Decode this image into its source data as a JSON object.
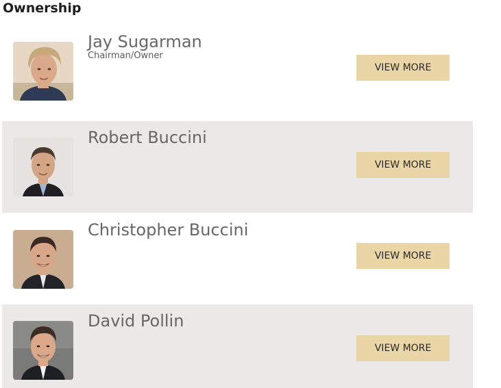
{
  "section": {
    "title": "Ownership"
  },
  "people": [
    {
      "name": "Jay Sugarman",
      "role": "Chairman/Owner",
      "button": "VIEW MORE",
      "photo": "portrait-photo",
      "photo_bg": "#e7d8c6",
      "hair": "#c6a87a",
      "skin": "#d9a98a",
      "suit": "#2f3a55"
    },
    {
      "name": "Robert Buccini",
      "role": "",
      "button": "VIEW MORE",
      "photo": "portrait-photo",
      "photo_bg": "#e6e2df",
      "hair": "#4a3a30",
      "skin": "#d4a585",
      "suit": "#1f1f24"
    },
    {
      "name": "Christopher Buccini",
      "role": "",
      "button": "VIEW MORE",
      "photo": "portrait-photo",
      "photo_bg": "#c9ad90",
      "hair": "#3a2a22",
      "skin": "#d7a787",
      "suit": "#232428"
    },
    {
      "name": "David Pollin",
      "role": "",
      "button": "VIEW MORE",
      "photo": "portrait-photo",
      "photo_bg": "#7a7a78",
      "hair": "#3b2c24",
      "skin": "#dba88a",
      "suit": "#1e1f22"
    }
  ],
  "colors": {
    "shaded_row": "#ebe9e7",
    "button_bg": "#e9d5a6",
    "name_text": "#676767"
  }
}
